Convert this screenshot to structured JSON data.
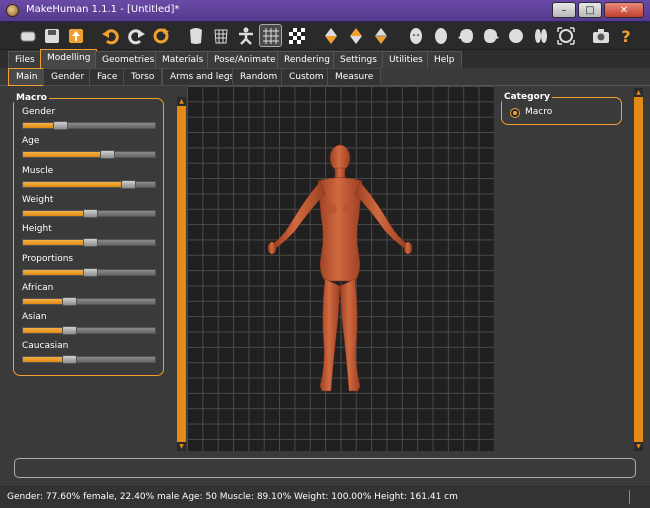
{
  "window": {
    "title": "MakeHuman 1.1.1 - [Untitled]*",
    "controls": [
      "–",
      "□",
      "✕"
    ]
  },
  "toolbar": {
    "icons": [
      "toggle-icon",
      "save-icon",
      "export-icon",
      "undo-icon",
      "redo-icon",
      "reset-icon",
      "smooth-icon",
      "wireframe-icon",
      "pose-icon",
      "grid-icon",
      "checker-icon",
      "front-view-icon",
      "left-view-icon",
      "right-view-icon",
      "face-front-icon",
      "head-oval-icon",
      "head-left-icon",
      "head-right-icon",
      "head-top-icon",
      "head-back-icon",
      "reset-camera-icon",
      "screenshot-icon",
      "help-icon"
    ]
  },
  "menu": {
    "tabs": [
      "Files",
      "Modelling",
      "Geometries",
      "Materials",
      "Pose/Animate",
      "Rendering",
      "Settings",
      "Utilities",
      "Help"
    ],
    "active": "Modelling"
  },
  "subtabs": {
    "tabs": [
      "Main",
      "Gender",
      "Face",
      "Torso",
      "Arms and legs",
      "Random",
      "Custom",
      "Measure"
    ],
    "active": "Main"
  },
  "macro_panel": {
    "title": "Macro",
    "sliders": [
      {
        "label": "Gender",
        "value": 0.25
      },
      {
        "label": "Age",
        "value": 0.65
      },
      {
        "label": "Muscle",
        "value": 0.82
      },
      {
        "label": "Weight",
        "value": 0.5
      },
      {
        "label": "Height",
        "value": 0.5
      },
      {
        "label": "Proportions",
        "value": 0.5
      },
      {
        "label": "African",
        "value": 0.33
      },
      {
        "label": "Asian",
        "value": 0.33
      },
      {
        "label": "Caucasian",
        "value": 0.33
      }
    ]
  },
  "category_panel": {
    "title": "Category",
    "option": "Macro"
  },
  "status": {
    "text": "Gender: 77.60% female, 22.40% male Age: 50 Muscle: 89.10% Weight: 100.00% Height: 161.41 cm"
  },
  "colors": {
    "accent": "#f0a030",
    "skin": "#c4623b",
    "viewport_bg": "#202020"
  }
}
